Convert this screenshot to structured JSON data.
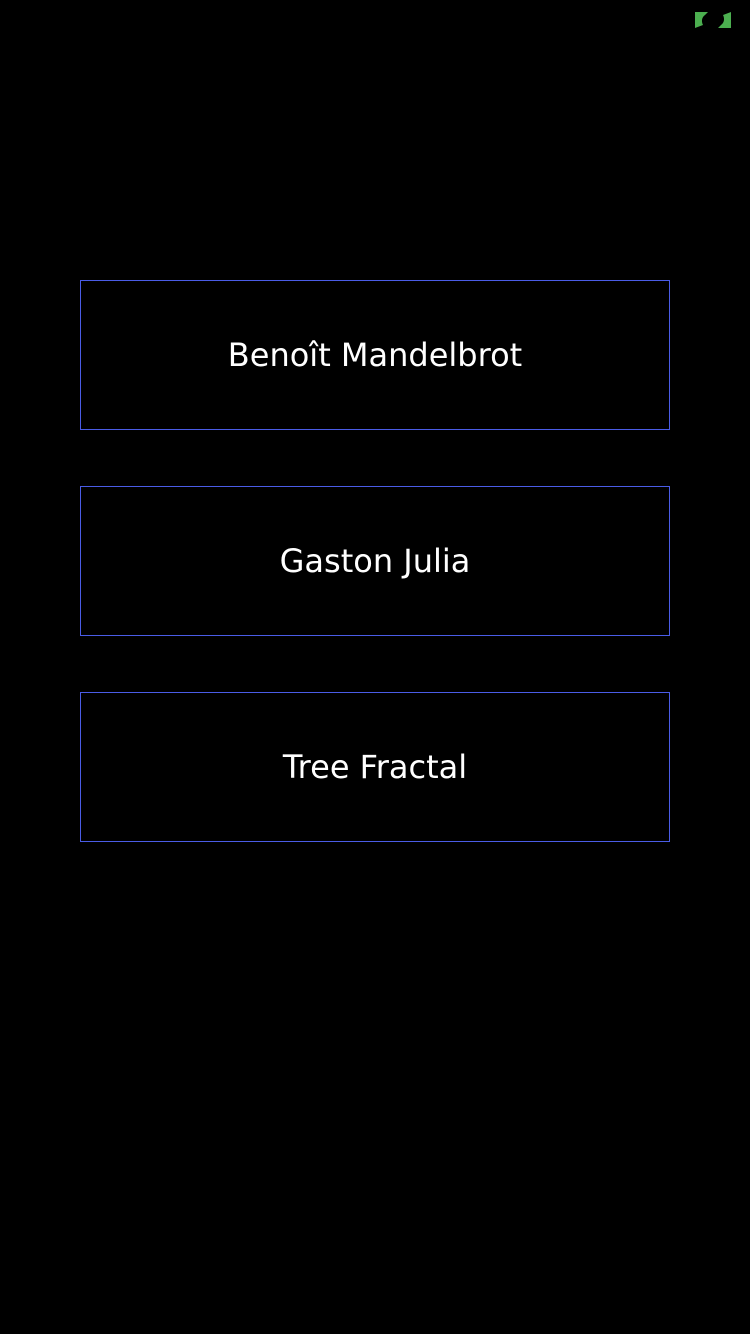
{
  "colors": {
    "background": "#000000",
    "button_border": "#4a5ce6",
    "button_text": "#ffffff",
    "badge": "#4caf50"
  },
  "corner_badge": {
    "icon": "expand-arrows-icon"
  },
  "menu": {
    "items": [
      {
        "label": "Benoît Mandelbrot"
      },
      {
        "label": "Gaston Julia"
      },
      {
        "label": "Tree Fractal"
      }
    ]
  }
}
